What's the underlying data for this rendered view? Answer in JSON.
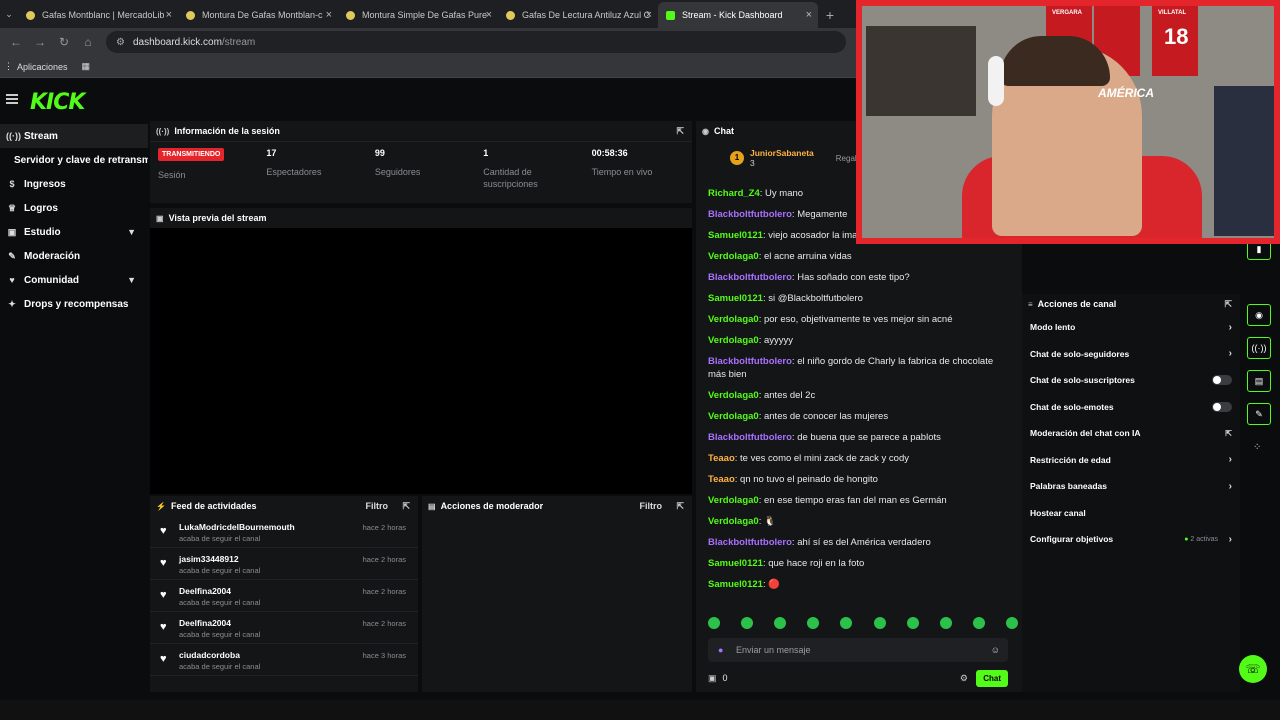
{
  "browser": {
    "tabs": [
      {
        "label": "Gafas Montblanc | MercadoLib"
      },
      {
        "label": "Montura De Gafas Montblan-c"
      },
      {
        "label": "Montura Simple De Gafas Pure"
      },
      {
        "label": "Gafas De Lectura Antiluz Azul C"
      },
      {
        "label": "Stream - Kick Dashboard"
      }
    ],
    "url_host": "dashboard.kick.com",
    "url_path": "/stream",
    "bookmark_label": "Aplicaciones"
  },
  "logo": "KICK",
  "sidebar": {
    "items": [
      {
        "label": "Stream",
        "icon": "broadcast-icon"
      },
      {
        "label": "Servidor y clave de retransm"
      },
      {
        "label": "Ingresos",
        "icon": "money-icon"
      },
      {
        "label": "Logros",
        "icon": "trophy-icon"
      },
      {
        "label": "Estudio",
        "icon": "studio-icon"
      },
      {
        "label": "Moderación",
        "icon": "wrench-icon"
      },
      {
        "label": "Comunidad",
        "icon": "community-icon"
      },
      {
        "label": "Drops y recompensas",
        "icon": "gift-icon"
      }
    ]
  },
  "session": {
    "title": "Información de la sesión",
    "stats": [
      {
        "value": "TRANSMITIENDO",
        "label": "Sesión"
      },
      {
        "value": "17",
        "label": "Espectadores"
      },
      {
        "value": "99",
        "label": "Seguidores"
      },
      {
        "value": "1",
        "label": "Cantidad de suscripciones"
      },
      {
        "value": "00:58:36",
        "label": "Tiempo en vivo"
      }
    ]
  },
  "preview": {
    "title": "Vista previa del stream"
  },
  "feed": {
    "title": "Feed de actividades",
    "filter": "Filtro",
    "items": [
      {
        "name": "LukaModricdelBournemouth",
        "sub": "acaba de seguir el canal",
        "time": "hace 2 horas"
      },
      {
        "name": "jasim33448912",
        "sub": "acaba de seguir el canal",
        "time": "hace 2 horas"
      },
      {
        "name": "Deelfina2004",
        "sub": "acaba de seguir el canal",
        "time": "hace 2 horas"
      },
      {
        "name": "Deelfina2004",
        "sub": "acaba de seguir el canal",
        "time": "hace 2 horas"
      },
      {
        "name": "ciudadcordoba",
        "sub": "acaba de seguir el canal",
        "time": "hace 3 horas"
      }
    ]
  },
  "modactions": {
    "title": "Acciones de moderador",
    "filter": "Filtro"
  },
  "chat": {
    "title": "Chat",
    "pinned_user": "JuniorSabaneta",
    "pinned_count": "3",
    "pinned_action": "Regala",
    "messages": [
      {
        "user": "Richard_Z4",
        "color": "g",
        "text": " Uy mano"
      },
      {
        "user": "Blackboltfutbolero",
        "color": "p",
        "text": " Megamente"
      },
      {
        "user": "Samuel0121",
        "color": "g",
        "text": " viejo acosador la imagen 1"
      },
      {
        "user": "Verdolaga0",
        "color": "g",
        "text": " el acne arruina vidas"
      },
      {
        "user": "Blackboltfutbolero",
        "color": "p",
        "text": " Has soñado con este tipo?"
      },
      {
        "user": "Samuel0121",
        "color": "g",
        "text": " si @Blackboltfutbolero"
      },
      {
        "user": "Verdolaga0",
        "color": "g",
        "text": " por eso, objetivamente te ves mejor sin acné"
      },
      {
        "user": "Verdolaga0",
        "color": "g",
        "text": " ayyyyy"
      },
      {
        "user": "Blackboltfutbolero",
        "color": "p",
        "text": " el niño gordo de Charly la fabrica de chocolate más bien"
      },
      {
        "user": "Verdolaga0",
        "color": "g",
        "text": " antes del 2c"
      },
      {
        "user": "Verdolaga0",
        "color": "g",
        "text": " antes de conocer las mujeres"
      },
      {
        "user": "Blackboltfutbolero",
        "color": "p",
        "text": " de buena que se parece a pablots"
      },
      {
        "user": "Teaao",
        "color": "o",
        "text": " te ves como el mini zack de zack y cody"
      },
      {
        "user": "Teaao",
        "color": "o",
        "text": " qn no tuvo el peinado de hongito"
      },
      {
        "user": "Verdolaga0",
        "color": "g",
        "text": " en ese tiempo eras fan del man es Germán"
      },
      {
        "user": "Verdolaga0",
        "color": "g",
        "text": " 🐧"
      },
      {
        "user": "Blackboltfutbolero",
        "color": "p",
        "text": " ahí sí es del América verdadero"
      },
      {
        "user": "Samuel0121",
        "color": "g",
        "text": " que hace roji en la foto"
      },
      {
        "user": "Samuel0121",
        "color": "g",
        "text": " 🔴"
      }
    ],
    "input_placeholder": "Enviar un mensaje",
    "points": "0",
    "send_label": "Chat"
  },
  "channel_actions": {
    "title": "Acciones de canal",
    "items": [
      {
        "label": "Modo lento",
        "control": "chevron"
      },
      {
        "label": "Chat de solo-seguidores",
        "control": "chevron"
      },
      {
        "label": "Chat de solo-suscriptores",
        "control": "toggle"
      },
      {
        "label": "Chat de solo-emotes",
        "control": "toggle"
      },
      {
        "label": "Moderación del chat con IA",
        "control": "external"
      },
      {
        "label": "Restricción de edad",
        "control": "chevron"
      },
      {
        "label": "Palabras baneadas",
        "control": "chevron"
      },
      {
        "label": "Hostear canal",
        "control": "none"
      },
      {
        "label": "Configurar objetivos",
        "control": "chevron",
        "extra": "2 activas"
      }
    ]
  },
  "webcam": {
    "jersey_1": "VERGARA",
    "jersey_2": "VILLATAL",
    "jersey_number": "18",
    "shirt_text": "AMÉRICA"
  },
  "colors": {
    "accent": "#53fc18",
    "live": "#e4262c",
    "bg": "#0b0c0d",
    "panel": "#141517"
  }
}
